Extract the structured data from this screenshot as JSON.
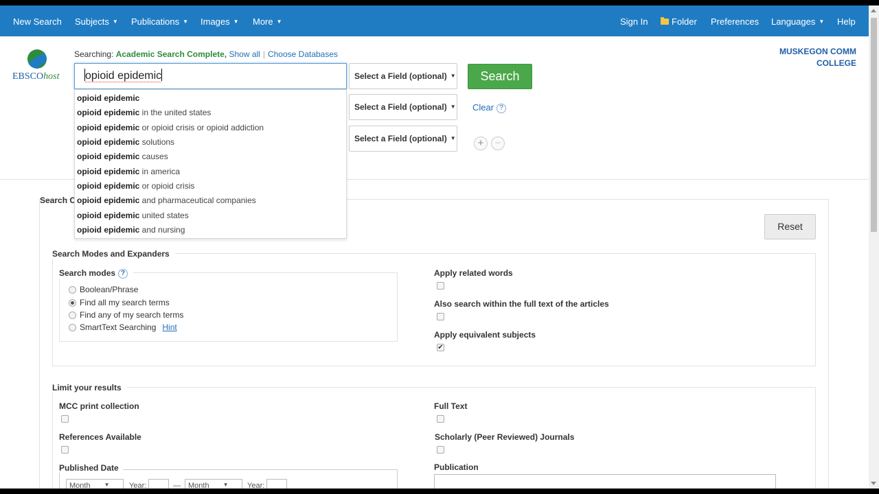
{
  "nav": {
    "new_search": "New Search",
    "subjects": "Subjects",
    "publications": "Publications",
    "images": "Images",
    "more": "More",
    "sign_in": "Sign In",
    "folder": "Folder",
    "preferences": "Preferences",
    "languages": "Languages",
    "help": "Help"
  },
  "logo": {
    "ebsco": "EBSCO",
    "host": "host"
  },
  "searching": {
    "label": "Searching:",
    "database": "Academic Search Complete,",
    "show_all": "Show all",
    "choose_databases": "Choose Databases"
  },
  "search": {
    "query_prefix": "",
    "query_text": "opioid epidemic",
    "field_select": "Select a Field (optional)",
    "button": "Search",
    "clear": "Clear",
    "help": "?",
    "add": "+",
    "remove": "−"
  },
  "institution": {
    "line1": "MUSKEGON COMM",
    "line2": "COLLEGE"
  },
  "autocomplete": [
    {
      "bold": "opioid epidemic",
      "rest": ""
    },
    {
      "bold": "opioid epidemic",
      "rest": " in the united states"
    },
    {
      "bold": "opioid epidemic",
      "rest": " or opioid crisis or opioid addiction"
    },
    {
      "bold": "opioid epidemic",
      "rest": " solutions"
    },
    {
      "bold": "opioid epidemic",
      "rest": " causes"
    },
    {
      "bold": "opioid epidemic",
      "rest": " in america"
    },
    {
      "bold": "opioid epidemic",
      "rest": " or opioid crisis"
    },
    {
      "bold": "opioid epidemic",
      "rest": " and pharmaceutical companies"
    },
    {
      "bold": "opioid epidemic",
      "rest": " united states"
    },
    {
      "bold": "opioid epidemic",
      "rest": " and nursing"
    }
  ],
  "options": {
    "title": "Search C",
    "reset": "Reset",
    "modes_expanders": "Search Modes and Expanders",
    "search_modes": "Search modes",
    "modes": [
      {
        "label": "Boolean/Phrase",
        "selected": false
      },
      {
        "label": "Find all my search terms",
        "selected": true
      },
      {
        "label": "Find any of my search terms",
        "selected": false
      },
      {
        "label": "SmartText Searching",
        "selected": false
      }
    ],
    "hint": "Hint",
    "apply_related": "Apply related words",
    "also_search_full_text": "Also search within the full text of the articles",
    "apply_equivalent": "Apply equivalent subjects",
    "limit_results": "Limit your results",
    "mcc_print": "MCC print collection",
    "full_text": "Full Text",
    "references_available": "References Available",
    "scholarly": "Scholarly (Peer Reviewed) Journals",
    "published_date": "Published Date",
    "publication": "Publication",
    "month": "Month",
    "year": "Year:",
    "dash": "—"
  },
  "colors": {
    "nav_bg": "#1f7cc3",
    "search_green": "#4aa84a",
    "link_blue": "#1f6fb5"
  }
}
